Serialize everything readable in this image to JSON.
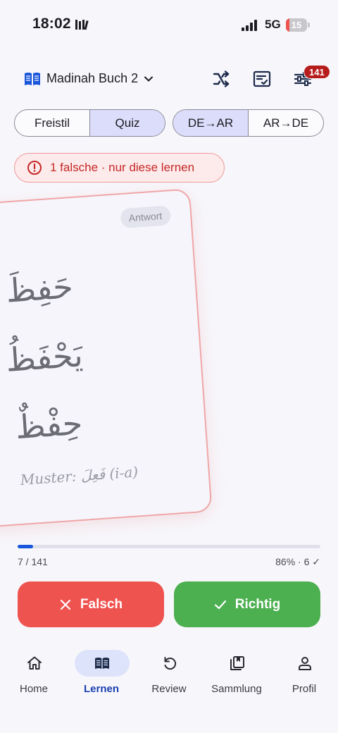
{
  "status_bar": {
    "time": "18:02",
    "network": "5G",
    "battery": "15"
  },
  "header": {
    "book_title": "Madinah Buch 2",
    "filter_badge": "141",
    "icons": [
      "book-icon",
      "chevron-down-icon",
      "shuffle-icon",
      "checklist-icon",
      "sliders-icon"
    ]
  },
  "mode_segment": {
    "options": [
      "Freistil",
      "Quiz"
    ],
    "active": "Quiz"
  },
  "direction_segment": {
    "options": [
      "DE→AR",
      "AR→DE"
    ],
    "active": "DE→AR"
  },
  "error_pill": {
    "text": "1 falsche · nur diese lernen"
  },
  "card": {
    "label": "Antwort",
    "arabic_lines": [
      "حَفِظَ",
      "يَحْفَظُ",
      "حِفْظٌ"
    ],
    "pattern": "Muster: فَعِلَ (i-a)"
  },
  "progress": {
    "count": "7 / 141",
    "stats": "86% · 6 ✓",
    "fraction": 0.05
  },
  "actions": {
    "wrong_label": "Falsch",
    "right_label": "Richtig"
  },
  "nav": {
    "items": [
      {
        "label": "Home",
        "icon": "home-icon"
      },
      {
        "label": "Lernen",
        "icon": "open-book-icon"
      },
      {
        "label": "Review",
        "icon": "undo-icon"
      },
      {
        "label": "Sammlung",
        "icon": "collection-icon"
      },
      {
        "label": "Profil",
        "icon": "person-icon"
      }
    ],
    "active": "Lernen"
  },
  "colors": {
    "accent": "#1a56db",
    "wrong": "#ef5350",
    "right": "#4caf50",
    "badge": "#b71c1c",
    "card_border": "#f0a6a8"
  }
}
